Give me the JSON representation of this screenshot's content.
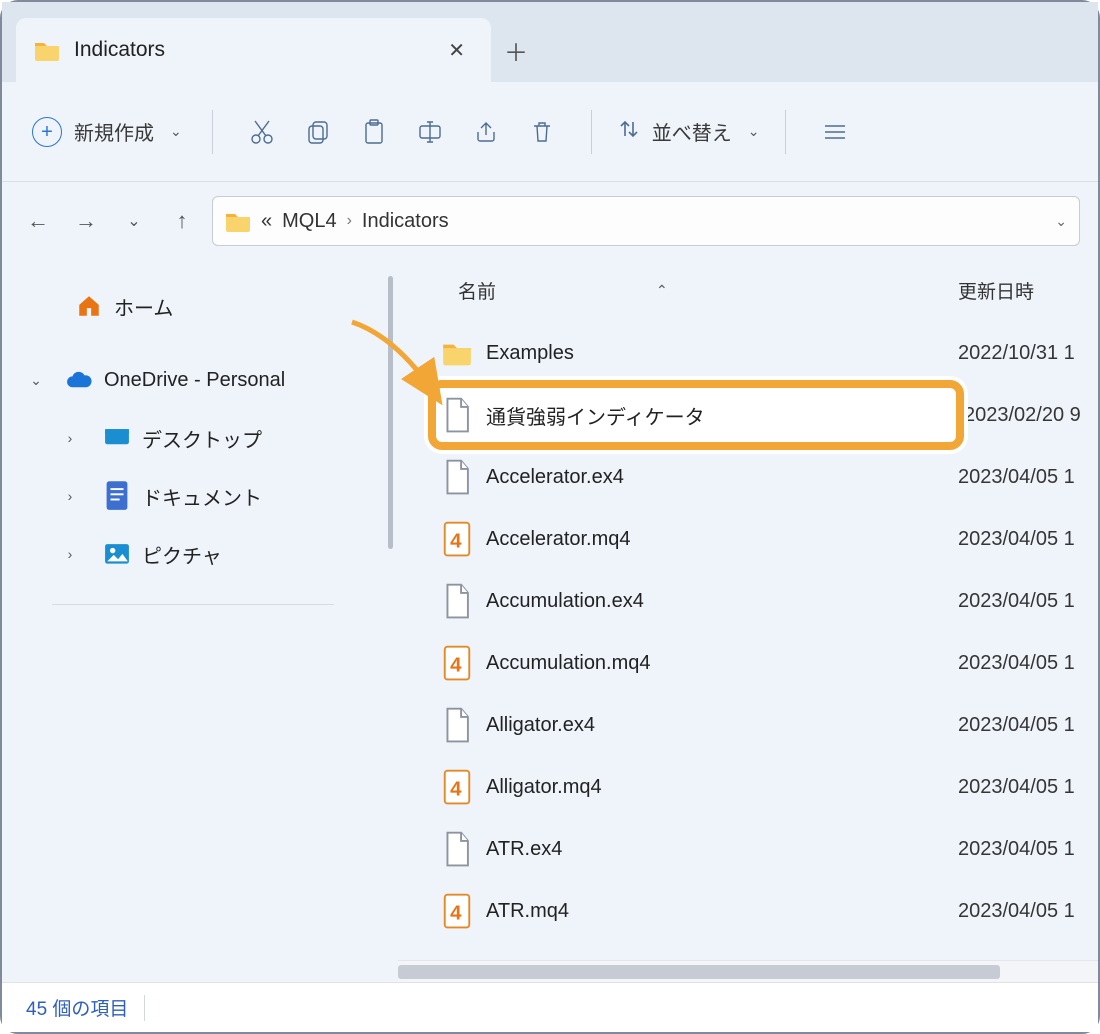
{
  "tab": {
    "title": "Indicators"
  },
  "toolbar": {
    "new_label": "新規作成",
    "sort_label": "並べ替え"
  },
  "breadcrumb": {
    "overflow": "«",
    "seg1": "MQL4",
    "seg2": "Indicators"
  },
  "sidebar": {
    "home": "ホーム",
    "onedrive": "OneDrive - Personal",
    "desktop": "デスクトップ",
    "documents": "ドキュメント",
    "pictures": "ピクチャ"
  },
  "columns": {
    "name": "名前",
    "date": "更新日時"
  },
  "files": [
    {
      "name": "Examples",
      "type": "folder",
      "date": "2022/10/31 1"
    },
    {
      "name": "通貨強弱インディケータ",
      "type": "file",
      "date": "2023/02/20 9",
      "highlight": true
    },
    {
      "name": "Accelerator.ex4",
      "type": "file",
      "date": "2023/04/05 1"
    },
    {
      "name": "Accelerator.mq4",
      "type": "mq4",
      "date": "2023/04/05 1"
    },
    {
      "name": "Accumulation.ex4",
      "type": "file",
      "date": "2023/04/05 1"
    },
    {
      "name": "Accumulation.mq4",
      "type": "mq4",
      "date": "2023/04/05 1"
    },
    {
      "name": "Alligator.ex4",
      "type": "file",
      "date": "2023/04/05 1"
    },
    {
      "name": "Alligator.mq4",
      "type": "mq4",
      "date": "2023/04/05 1"
    },
    {
      "name": "ATR.ex4",
      "type": "file",
      "date": "2023/04/05 1"
    },
    {
      "name": "ATR.mq4",
      "type": "mq4",
      "date": "2023/04/05 1"
    }
  ],
  "status": {
    "count": "45 個の項目"
  }
}
